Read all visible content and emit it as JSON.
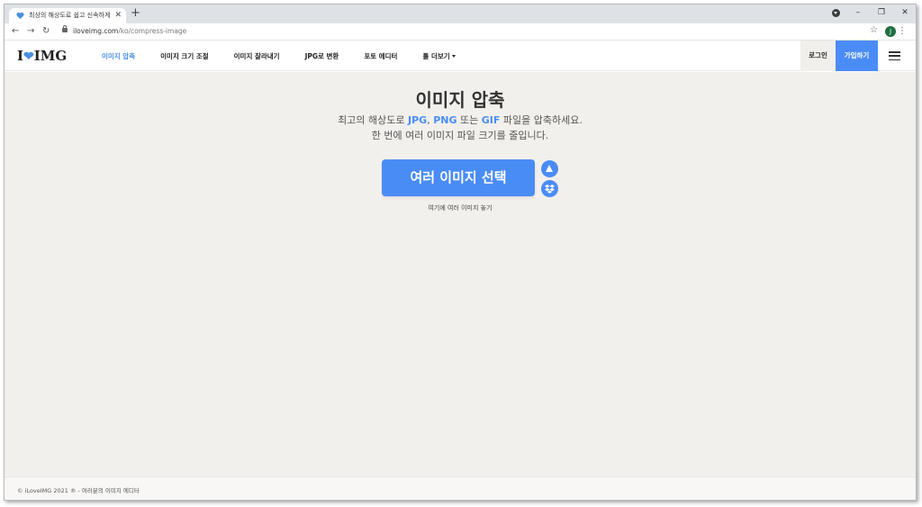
{
  "browser": {
    "tab_title": "최상의 해상도로 쉽고 신속하게",
    "tab_close": "✕",
    "new_tab": "+",
    "back": "←",
    "forward": "→",
    "reload": "↻",
    "url_host": "iloveimg.com",
    "url_path": "/ko/compress-image",
    "bookmark": "☆",
    "profile_initial": "J",
    "menu": "⋮",
    "minimize": "–",
    "restore": "❐",
    "close": "✕"
  },
  "header": {
    "logo_left": "I",
    "logo_heart": "❤",
    "logo_right": "IMG",
    "nav": [
      {
        "label": "이미지 압축",
        "active": true
      },
      {
        "label": "이미지 크기 조절"
      },
      {
        "label": "이미지 잘라내기"
      },
      {
        "label": "JPG로 변환"
      },
      {
        "label": "포토 에디터"
      },
      {
        "label": "툴 더보기"
      }
    ],
    "login": "로그인",
    "signup": "가입하기"
  },
  "main": {
    "title": "이미지 압축",
    "subtitle_1": "최고의 해상도로 ",
    "fmt_jpg": "JPG",
    "sep_1": ", ",
    "fmt_png": "PNG",
    "subtitle_2": " 또는 ",
    "fmt_gif": "GIF",
    "subtitle_3": " 파일을 압축하세요.",
    "subtitle_line2": "한 번에 여러 이미지 파일 크기를 줄입니다.",
    "select_button": "여러 이미지 선택",
    "drop_hint": "여기에 여러 이미지 놓기"
  },
  "footer": {
    "text": "© iLoveIMG 2021 ® - 여러분의 이미지 에디터"
  },
  "colors": {
    "accent": "#4a8cf5",
    "background": "#f2f0ec"
  }
}
